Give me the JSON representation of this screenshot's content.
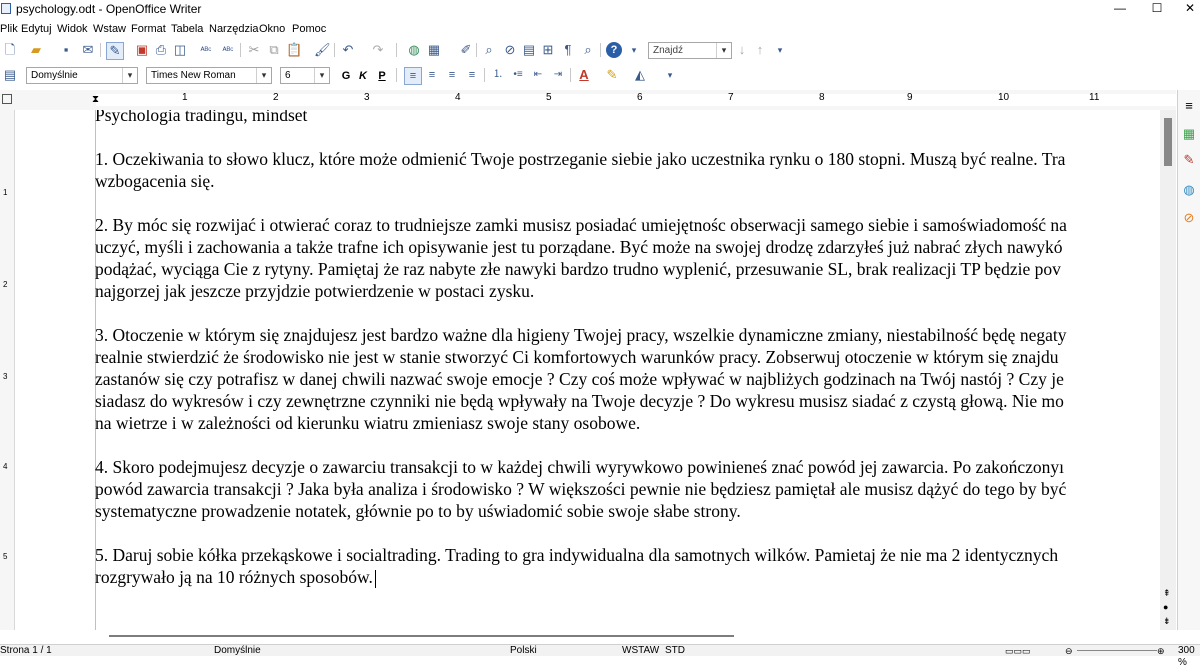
{
  "window": {
    "title": "psychology.odt - OpenOffice Writer",
    "minimize": "—",
    "maximize": "☐",
    "close": "✕"
  },
  "menu": {
    "items": [
      "Plik",
      "Edytuj",
      "Widok",
      "Wstaw",
      "Format",
      "Tabela",
      "Narzędzia",
      "Okno",
      "Pomoc"
    ]
  },
  "toolbar": {
    "find_placeholder": "Znajdź"
  },
  "formatting": {
    "style": "Domyślnie",
    "font": "Times New Roman",
    "size": "6",
    "bold": "G",
    "italic": "K",
    "underline": "P"
  },
  "ruler": {
    "ticks": [
      "1",
      "2",
      "3",
      "4",
      "5",
      "6",
      "7",
      "8",
      "9",
      "10",
      "11"
    ],
    "left_ticks": [
      "1",
      "2",
      "3",
      "4",
      "5"
    ]
  },
  "document": {
    "heading": "Psychologia tradingu, mindset",
    "paragraphs": [
      [
        "1. Oczekiwania to słowo klucz, które może odmienić Twoje postrzeganie siebie jako uczestnika rynku o 180 stopni. Muszą być realne. Tra",
        "wzbogacenia się."
      ],
      [
        "2. By móc się rozwijać i otwierać coraz to trudniejsze zamki musisz posiadać umiejętnośc obserwacji samego siebie i samoświadomość na",
        "uczyć, myśli i zachowania a także trafne ich opisywanie jest tu porządane. Być może na swojej drodzę zdarzyłeś już nabrać złych nawykó",
        "podążać, wyciąga Cie z rytyny. Pamiętaj że raz nabyte złe nawyki bardzo trudno wyplenić, przesuwanie SL, brak realizacji TP będzie pov",
        "najgorzej jak jeszcze przyjdzie potwierdzenie w postaci zysku."
      ],
      [
        "3. Otoczenie w którym się znajdujesz jest bardzo ważne dla higieny Twojej pracy, wszelkie dynamiczne zmiany, niestabilność będę negaty",
        "realnie stwierdzić że środowisko nie jest w stanie stworzyć Ci komfortowych warunków pracy.  Zobserwuj otoczenie w którym się znajdu",
        "zastanów się czy potrafisz w danej chwili nazwać swoje emocje ? Czy coś może wpływać w najbliżych godzinach na  Twój nastój ? Czy je",
        "siadasz do wykresów i czy zewnętrzne czynniki nie będą wpływały na Twoje decyzje ? Do wykresu musisz siadać z czystą głową. Nie mo",
        "na wietrze i w zależności od kierunku wiatru zmieniasz swoje stany osobowe."
      ],
      [
        "4. Skoro podejmujesz decyzje o zawarciu transakcji to w każdej chwili wyrywkowo powinieneś znać powód jej zawarcia. Po zakończonyı",
        "powód zawarcia transakcji ? Jaka była analiza i środowisko ? W większości pewnie nie będziesz pamiętał ale musisz dążyć do tego by być",
        "systematyczne prowadzenie notatek, głównie po to by uświadomić sobie swoje słabe strony."
      ],
      [
        "5. Daruj sobie kółka przekąskowe i socialtrading. Trading to gra indywidualna dla samotnych wilków. Pamietaj że nie ma 2 identycznych",
        "rozgrywało ją na 10 różnych sposobów."
      ]
    ]
  },
  "status": {
    "page": "Strona  1 / 1",
    "style": "Domyślnie",
    "language": "Polski",
    "insert_mode": "WSTAW",
    "selection_mode": "STD",
    "zoom": "300 %"
  }
}
